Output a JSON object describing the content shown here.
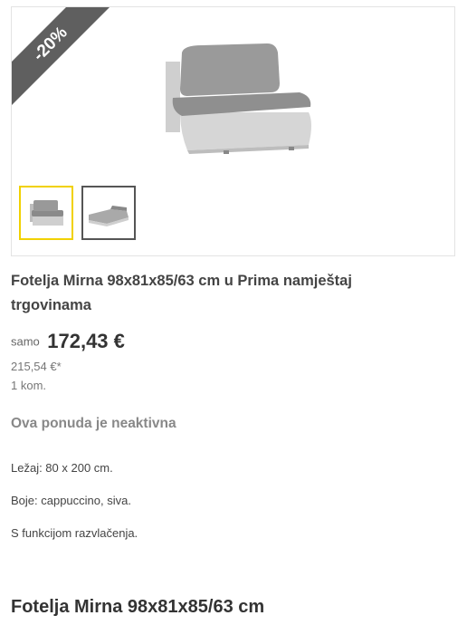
{
  "gallery": {
    "discount_badge": "-20%",
    "main_image": "armchair-photo",
    "thumbnails": [
      "armchair-front-thumbnail",
      "armchair-bed-thumbnail"
    ]
  },
  "product": {
    "title": "Fotelja Mirna 98x81x85/63 cm u Prima namještaj trgovinama",
    "price_prefix": "samo",
    "price": "172,43 €",
    "old_price": "215,54 €*",
    "quantity": "1 kom.",
    "status": "Ova ponuda je neaktivna",
    "features": [
      "Ležaj: 80 x 200 cm.",
      "Boje: cappuccino, siva.",
      "S funkcijom razvlačenja."
    ]
  },
  "section": {
    "heading": "Fotelja Mirna 98x81x85/63 cm"
  },
  "colors": {
    "badge": "#5f5f5f",
    "active_thumb_border": "#f1d100"
  }
}
